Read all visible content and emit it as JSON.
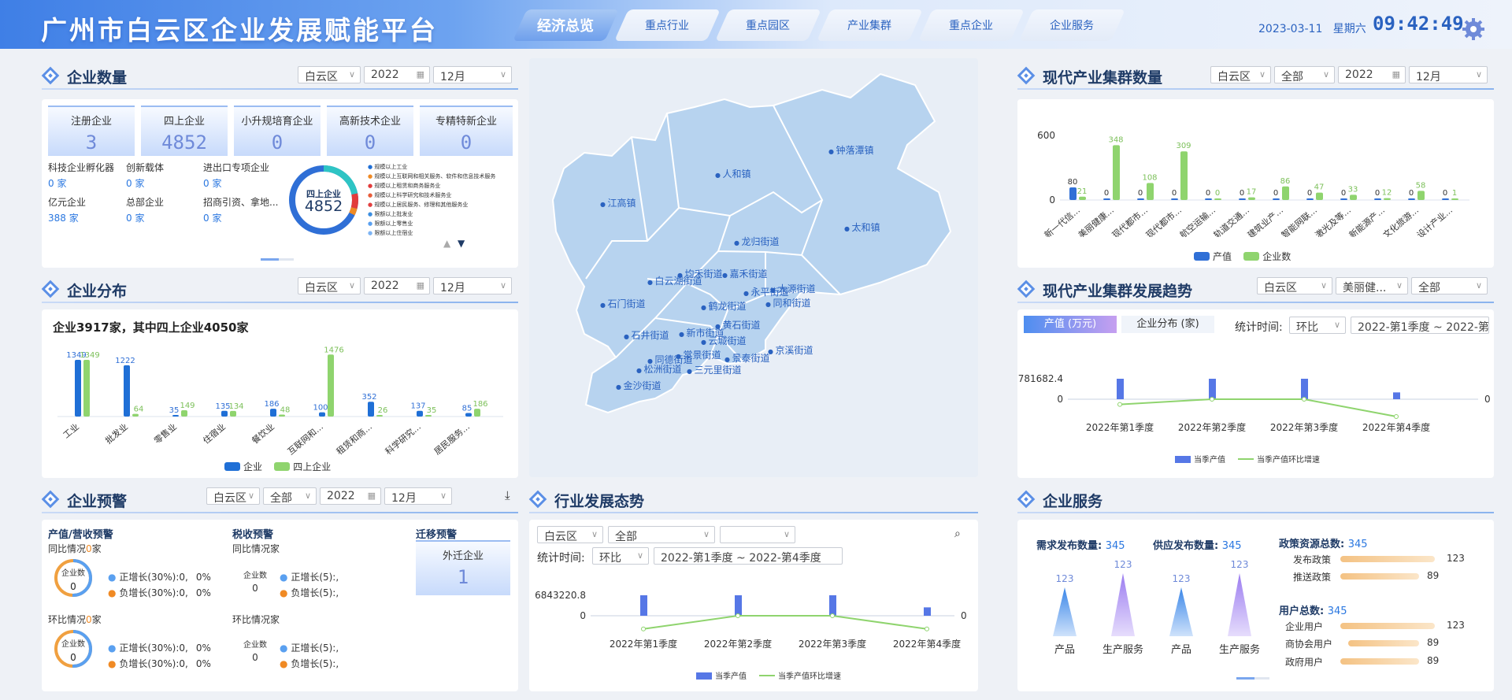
{
  "header": {
    "title": "广州市白云区企业发展赋能平台",
    "nav": [
      "经济总览",
      "重点行业",
      "重点园区",
      "产业集群",
      "重点企业",
      "企业服务"
    ],
    "nav_active": "经济总览",
    "date": "2023-03-11",
    "weekday": "星期六",
    "time": "09:42:49",
    "gear_icon": "gear-icon"
  },
  "count_panel": {
    "title": "企业数量",
    "filters": {
      "region": "白云区",
      "year": "2022",
      "month": "12月"
    },
    "stats": [
      {
        "label": "注册企业",
        "value": "3"
      },
      {
        "label": "四上企业",
        "value": "4852"
      },
      {
        "label": "小升规培育企业",
        "value": "0"
      },
      {
        "label": "高新技术企业",
        "value": "0"
      },
      {
        "label": "专精特新企业",
        "value": "0"
      }
    ],
    "minis": [
      {
        "label": "科技企业孵化器",
        "value": "0 家"
      },
      {
        "label": "创新载体",
        "value": "0 家"
      },
      {
        "label": "进出口专项企业",
        "value": "0 家"
      },
      {
        "label": "亿元企业",
        "value": "388 家"
      },
      {
        "label": "总部企业",
        "value": "0 家"
      },
      {
        "label": "招商引资、拿地...",
        "value": "0 家"
      }
    ],
    "donut_label": "四上企业",
    "donut_value": "4852",
    "legend": [
      "规模以上工业",
      "规模以上互联网和相关服务、软件和信息技术服务",
      "规模以上租赁和商务服务业",
      "规模以上科学研究和技术服务业",
      "规模以上居民服务、修理和其他服务业",
      "限额以上批发业",
      "限额以上零售业",
      "限额以上住宿业"
    ],
    "legend_colors": [
      "#1f6fd6",
      "#f08a24",
      "#e23b3b",
      "#e85d3a",
      "#e24040",
      "#3b8ee0",
      "#5aa0f0",
      "#7db4f4"
    ]
  },
  "dist_panel": {
    "title": "企业分布",
    "filters": {
      "region": "白云区",
      "year": "2022",
      "month": "12月"
    },
    "summary": "企业3917家，其中四上企业4050家",
    "legend": [
      "企业",
      "四上企业"
    ]
  },
  "warn_panel": {
    "title": "企业预警",
    "filters": {
      "region": "白云区",
      "type": "全部",
      "year": "2022",
      "month": "12月"
    },
    "output_title": "产值/营收预警",
    "yoy_label": "同比情况",
    "yoy_count": "0",
    "mom_label": "环比情况",
    "mom_count": "0",
    "unit": "家",
    "donut_label": "企业数",
    "donut_value": "0",
    "pos_30": "正增长(30%):0,",
    "neg_30": "负增长(30%):0,",
    "pct": "0%",
    "tax_title": "税收预警",
    "tax_yoy": "同比情况家",
    "tax_mom": "环比情况家",
    "tax_donut_label": "企业数",
    "tax_donut_value": "0",
    "pos_5": "正增长(5):,",
    "neg_5": "负增长(5):,",
    "move_title": "迁移预警",
    "move_label": "外迁企业",
    "move_value": "1"
  },
  "map": {
    "towns": [
      "钟落潭镇",
      "人和镇",
      "江高镇",
      "太和镇",
      "龙归街道",
      "均禾街道",
      "嘉禾街道",
      "白云湖街道",
      "大源街道",
      "永平街道",
      "同和街道",
      "石门街道",
      "鹤龙街道",
      "黄石街道",
      "石井街道",
      "新市街道",
      "云城街道",
      "京溪街道",
      "景泰街道",
      "棠景街道",
      "同德街道",
      "松洲街道",
      "三元里街道",
      "金沙街道"
    ]
  },
  "industry_panel": {
    "title": "行业发展态势",
    "filters": {
      "region": "白云区",
      "type": "全部",
      "extra": ""
    },
    "stat_time_label": "统计时间:",
    "compare": "环比",
    "range": "2022-第1季度 ~ 2022-第4季度",
    "ymax": "6843220.8",
    "legend": [
      "当季产值",
      "当季产值环比增速"
    ]
  },
  "cluster_panel": {
    "title": "现代产业集群数量",
    "filters": {
      "region": "白云区",
      "type": "全部",
      "year": "2022",
      "month": "12月"
    },
    "legend": [
      "产值",
      "企业数"
    ]
  },
  "trend_panel": {
    "title": "现代产业集群发展趋势",
    "filters": {
      "region": "白云区",
      "type": "美丽健...",
      "scope": "全部"
    },
    "tabs": [
      "产值 (万元)",
      "企业分布 (家)"
    ],
    "stat_time_label": "统计时间:",
    "compare": "环比",
    "range": "2022-第1季度 ~ 2022-第4季度",
    "ymax": "781682.4",
    "legend": [
      "当季产值",
      "当季产值环比增速"
    ]
  },
  "service_panel": {
    "title": "企业服务",
    "demand_label": "需求发布数量:",
    "demand_value": "345",
    "supply_label": "供应发布数量:",
    "supply_value": "345",
    "policy_label": "政策资源总数:",
    "policy_value": "345",
    "policy_items": [
      {
        "label": "发布政策",
        "value": "123"
      },
      {
        "label": "推送政策",
        "value": "89"
      }
    ],
    "user_label": "用户总数:",
    "user_value": "345",
    "user_items": [
      {
        "label": "企业用户",
        "value": "123"
      },
      {
        "label": "商协会用户",
        "value": "89"
      },
      {
        "label": "政府用户",
        "value": "89"
      }
    ],
    "spikes": [
      {
        "label": "产品",
        "value": "123"
      },
      {
        "label": "生产服务",
        "value": "123"
      },
      {
        "label": "产品",
        "value": "123"
      },
      {
        "label": "生产服务",
        "value": "123"
      }
    ]
  },
  "chart_data": [
    {
      "type": "bar",
      "id": "dist",
      "categories": [
        "工业",
        "批发业",
        "零售业",
        "住宿业",
        "餐饮业",
        "互联网和...",
        "租赁和商...",
        "科学研究...",
        "居民服务..."
      ],
      "series": [
        {
          "name": "企业",
          "values": [
            1349,
            1222,
            35,
            135,
            186,
            100,
            352,
            137,
            85
          ]
        },
        {
          "name": "四上企业",
          "values": [
            1349,
            64,
            149,
            134,
            48,
            1476,
            26,
            35,
            186
          ]
        }
      ],
      "value_labels": [
        [
          "1349",
          "1222",
          "35",
          "135",
          "186",
          "100",
          "352",
          "137",
          "85"
        ],
        [
          "1349",
          "64",
          "149",
          "134",
          "48",
          "1476",
          "26",
          "35",
          "186"
        ]
      ],
      "colors": [
        "#1f6fd6",
        "#8fd46e"
      ],
      "ylim": [
        0,
        1500
      ]
    },
    {
      "type": "bar",
      "id": "cluster",
      "categories": [
        "新一代信...",
        "美丽健康...",
        "现代都市...",
        "现代都市...",
        "航空运输...",
        "轨道交通...",
        "建筑业产...",
        "智能网联...",
        "激光及等...",
        "新能源产...",
        "文化旅游...",
        "设计产业..."
      ],
      "series": [
        {
          "name": "产值",
          "values": [
            80,
            0,
            0,
            0,
            0,
            0,
            0,
            0,
            0,
            0,
            0,
            0
          ]
        },
        {
          "name": "企业数",
          "values": [
            21,
            348,
            108,
            309,
            0,
            17,
            86,
            47,
            33,
            12,
            58,
            1
          ]
        }
      ],
      "colors": [
        "#2f6fd6",
        "#8fd46e"
      ],
      "yticks": [
        0,
        600
      ],
      "ylim": [
        0,
        600
      ]
    },
    {
      "type": "bar",
      "id": "trend",
      "categories": [
        "2022年第1季度",
        "2022年第2季度",
        "2022年第3季度",
        "2022年第4季度"
      ],
      "series": [
        {
          "name": "当季产值",
          "values": [
            781682.4,
            781682.4,
            781682.4,
            260000
          ]
        },
        {
          "name": "当季产值环比增速",
          "values": [
            -0.3,
            0,
            0,
            -1
          ]
        }
      ],
      "ylim": [
        0,
        781682.4
      ]
    },
    {
      "type": "bar",
      "id": "industry",
      "categories": [
        "2022年第1季度",
        "2022年第2季度",
        "2022年第3季度",
        "2022年第4季度"
      ],
      "series": [
        {
          "name": "当季产值",
          "values": [
            6843220.8,
            6843220.8,
            6843220.8,
            2800000
          ]
        },
        {
          "name": "当季产值环比增速",
          "values": [
            -0.7,
            0,
            0,
            -0.7
          ]
        }
      ],
      "ylim": [
        0,
        6843220.8
      ]
    }
  ]
}
